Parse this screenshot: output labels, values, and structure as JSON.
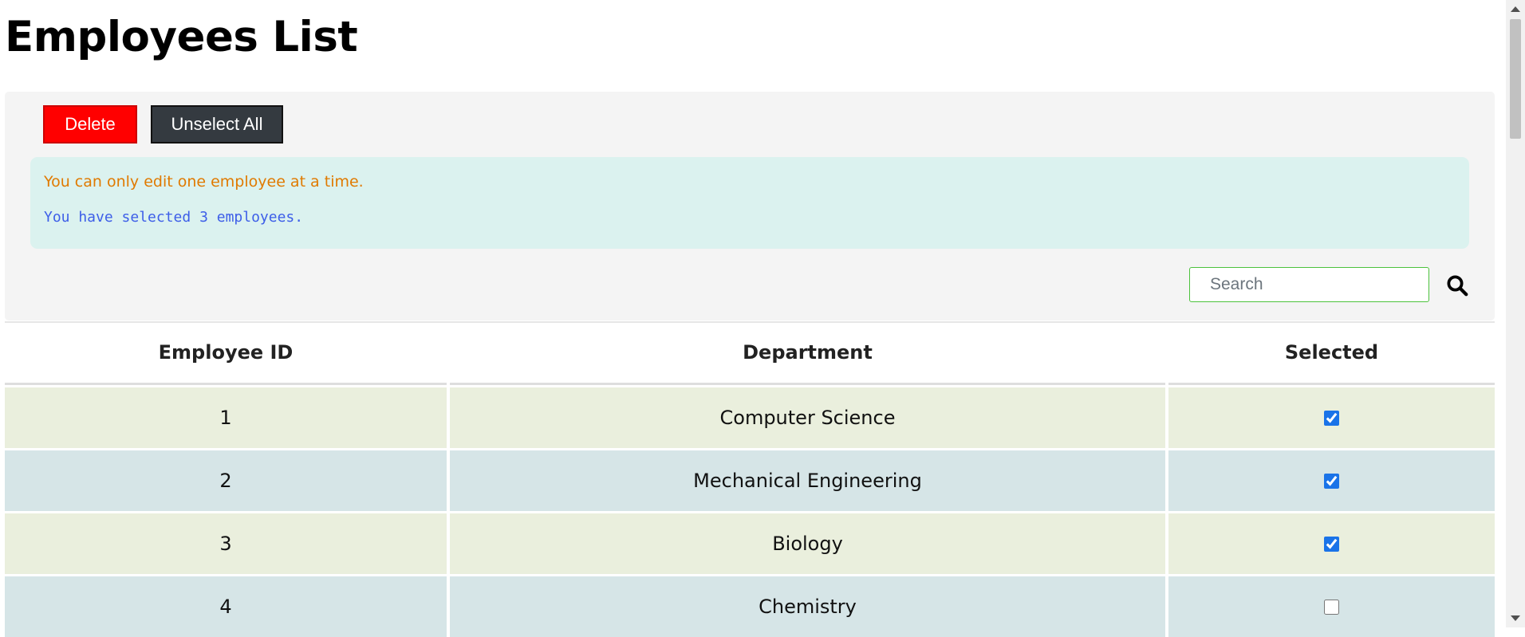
{
  "page": {
    "title": "Employees List"
  },
  "toolbar": {
    "delete_label": "Delete",
    "unselect_label": "Unselect All",
    "delete_color": "#ff0000",
    "unselect_color": "#343a40"
  },
  "info": {
    "warning": "You can only edit one employee at a time.",
    "selection_count": "You have selected 3 employees."
  },
  "search": {
    "placeholder": "Search",
    "value": "",
    "icon": "search-icon"
  },
  "table": {
    "columns": [
      "Employee ID",
      "Department",
      "Selected"
    ],
    "rows": [
      {
        "id": "1",
        "department": "Computer Science",
        "selected": true
      },
      {
        "id": "2",
        "department": "Mechanical Engineering",
        "selected": true
      },
      {
        "id": "3",
        "department": "Biology",
        "selected": true
      },
      {
        "id": "4",
        "department": "Chemistry",
        "selected": false
      }
    ]
  },
  "colors": {
    "row_odd": "#eaefdd",
    "row_even": "#d6e5e7",
    "info_background": "#dbf2ef",
    "warning_text": "#e07a00",
    "count_text": "#3d5ee8",
    "search_border": "#4cc23c"
  }
}
